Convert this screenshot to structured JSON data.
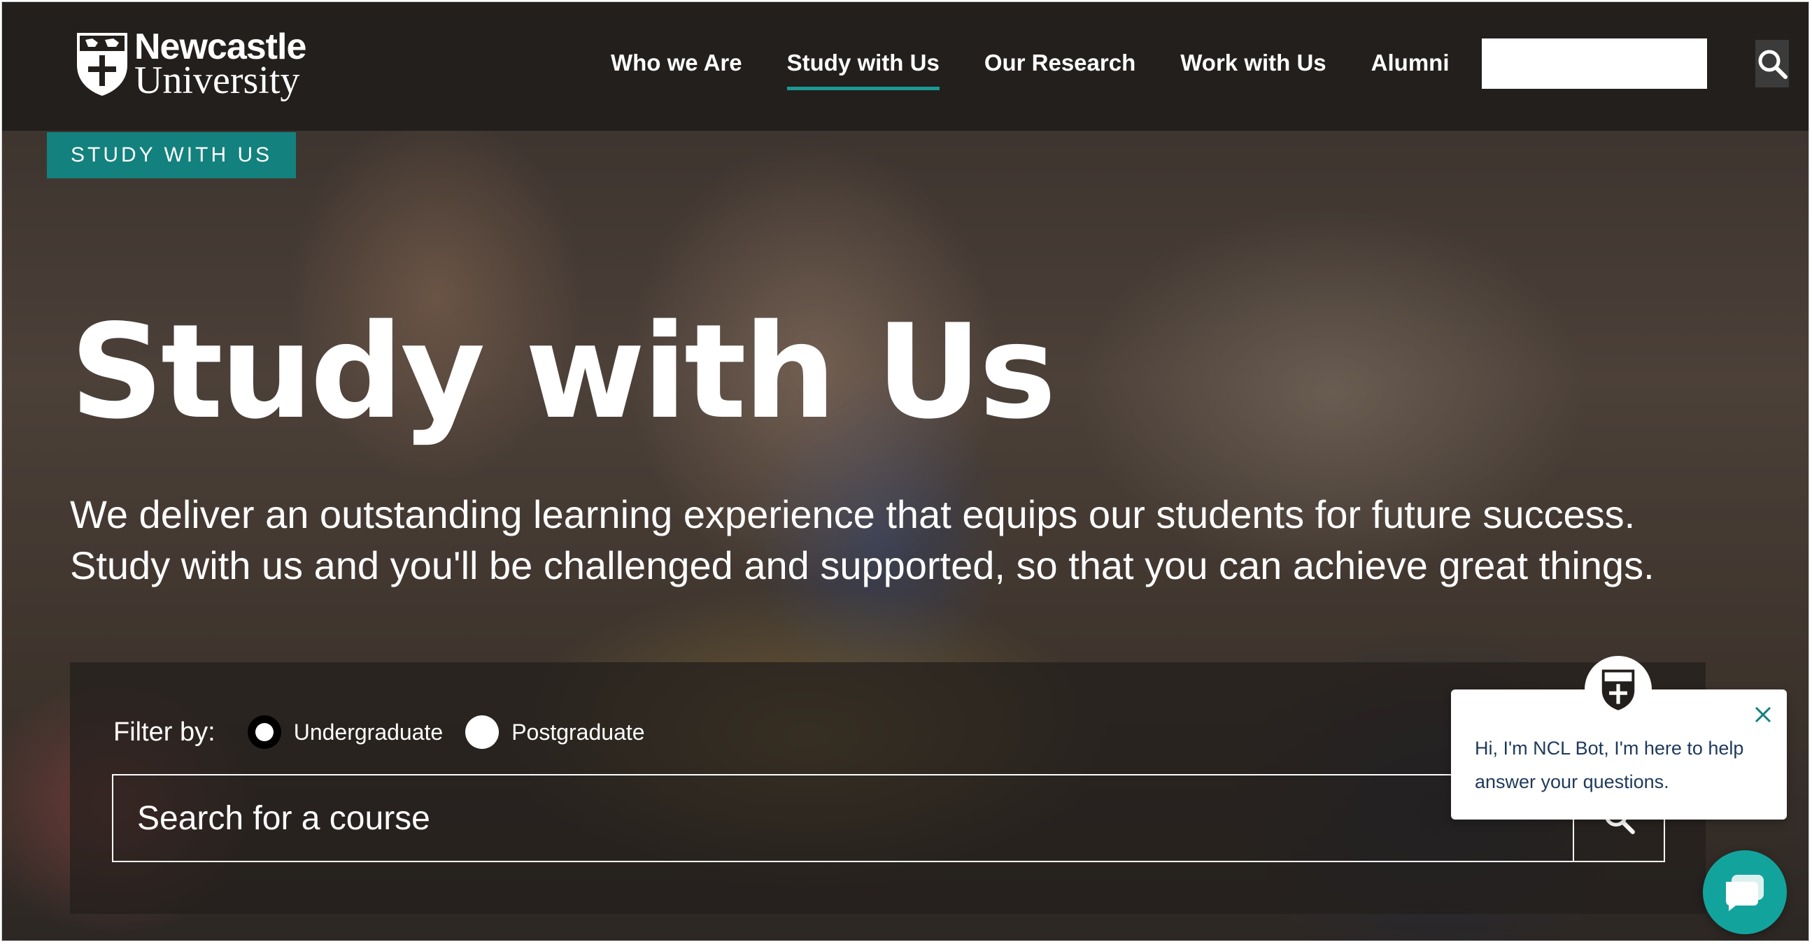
{
  "header": {
    "logo": {
      "line1": "Newcastle",
      "line2": "University"
    },
    "nav": [
      {
        "label": "Who we Are",
        "active": false
      },
      {
        "label": "Study with Us",
        "active": true
      },
      {
        "label": "Our Research",
        "active": false
      },
      {
        "label": "Work with Us",
        "active": false
      },
      {
        "label": "Alumni",
        "active": false
      }
    ],
    "search": {
      "value": "",
      "icon": "search-icon"
    }
  },
  "hero": {
    "tag": "STUDY WITH US",
    "title": "Study with Us",
    "description": "We deliver an outstanding learning experience that equips our students for future success. Study with us and you'll be challenged and supported, so that you can achieve great things."
  },
  "course_search": {
    "filter_label": "Filter by:",
    "options": [
      {
        "label": "Undergraduate",
        "selected": true
      },
      {
        "label": "Postgraduate",
        "selected": false
      }
    ],
    "placeholder": "Search for a course",
    "icon": "search-icon"
  },
  "chat": {
    "message": "Hi, I'm NCL Bot, I'm here to help answer your questions.",
    "close_icon": "close-icon",
    "launcher_icon": "chat-icon"
  },
  "colors": {
    "header_bg": "#231f1c",
    "accent": "#13817d",
    "nav_underline": "#1a9a93",
    "chat_launcher": "#13a39d",
    "chat_text": "#1f3a5a"
  }
}
